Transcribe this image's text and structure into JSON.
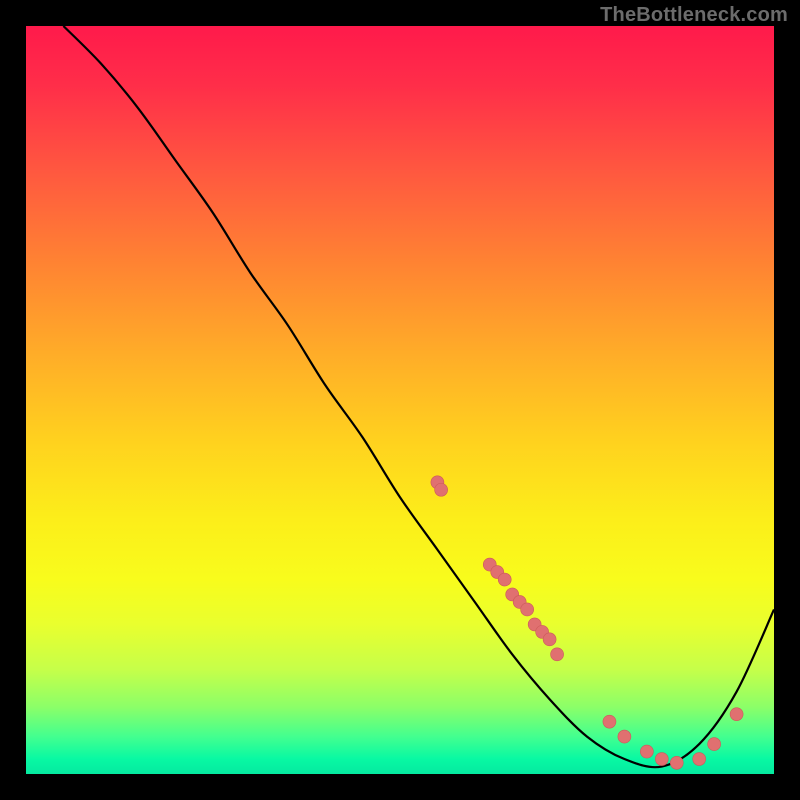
{
  "watermark": "TheBottleneck.com",
  "chart_data": {
    "type": "line",
    "title": "",
    "xlabel": "",
    "ylabel": "",
    "xlim": [
      0,
      100
    ],
    "ylim": [
      0,
      100
    ],
    "grid": false,
    "series": [
      {
        "name": "bottleneck-curve",
        "x": [
          5,
          10,
          15,
          20,
          25,
          30,
          35,
          40,
          45,
          50,
          55,
          60,
          65,
          70,
          75,
          80,
          85,
          90,
          95,
          100
        ],
        "y": [
          100,
          95,
          89,
          82,
          75,
          67,
          60,
          52,
          45,
          37,
          30,
          23,
          16,
          10,
          5,
          2,
          1,
          4,
          11,
          22
        ]
      }
    ],
    "markers": {
      "name": "sample-points",
      "color": "#e07070",
      "x": [
        55,
        55.5,
        62,
        63,
        64,
        65,
        66,
        67,
        68,
        69,
        70,
        71,
        78,
        80,
        83,
        85,
        87,
        90,
        92,
        95
      ],
      "y": [
        39,
        38,
        28,
        27,
        26,
        24,
        23,
        22,
        20,
        19,
        18,
        16,
        7,
        5,
        3,
        2,
        1.5,
        2,
        4,
        8
      ]
    },
    "colors": {
      "curve": "#000000",
      "gradient_top": "#ff1a4b",
      "gradient_mid": "#ffe41e",
      "gradient_bottom": "#05e9a0"
    }
  }
}
